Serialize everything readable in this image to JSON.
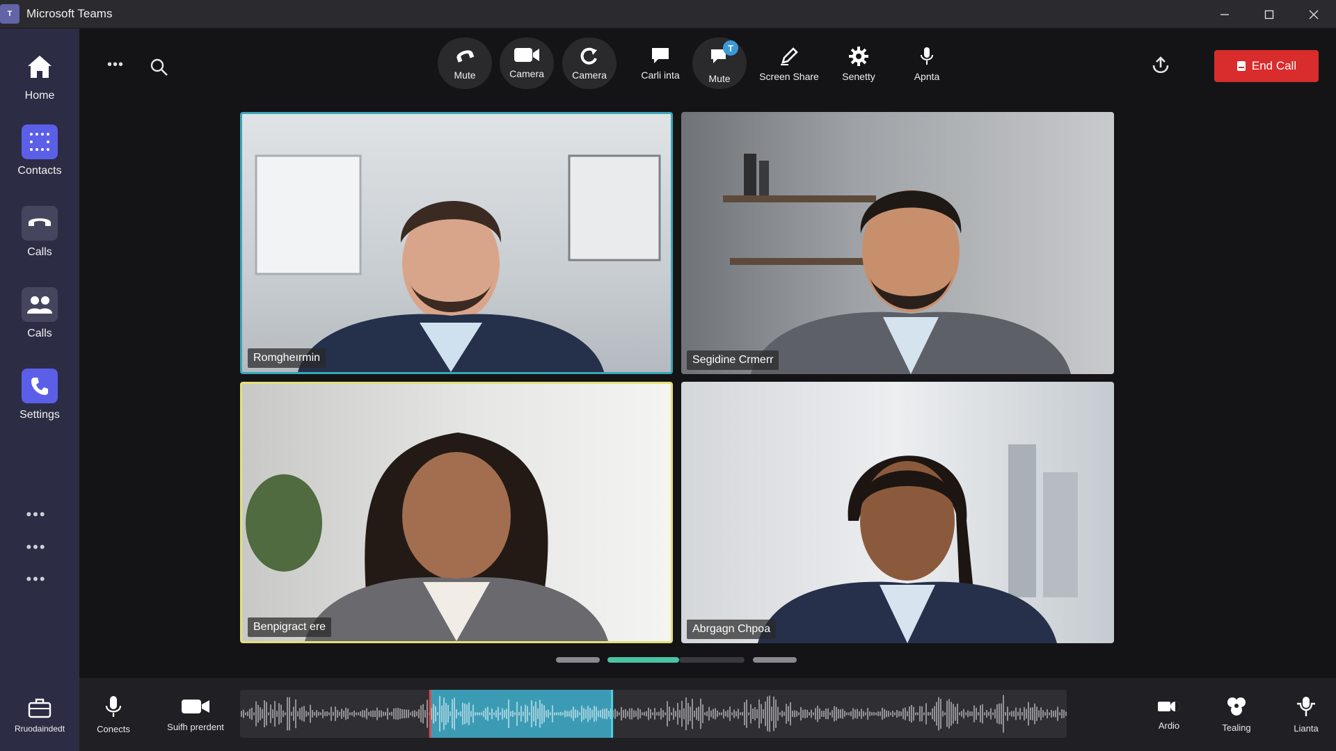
{
  "window": {
    "app_name": "Microsoft Teams",
    "logo_text": "T"
  },
  "nav": {
    "items": [
      {
        "label": "Home"
      },
      {
        "label": "Contacts"
      },
      {
        "label": "Calls"
      },
      {
        "label": "Calls"
      },
      {
        "label": "Settings"
      }
    ],
    "dots": [
      "•••",
      "•••",
      "•••"
    ],
    "bottom_label": "Rruodaindedt"
  },
  "toolbar": {
    "more": "•••",
    "tools": [
      {
        "label": "Mute",
        "icon": "headset-icon"
      },
      {
        "label": "Camera",
        "icon": "video-camera-icon"
      },
      {
        "label": "Camera",
        "icon": "switch-camera-icon"
      },
      {
        "label": "Carli inta",
        "icon": "chat-icon"
      },
      {
        "label": "Mute",
        "icon": "chat-badge-icon",
        "badge": "T"
      },
      {
        "label": "Screen Share",
        "icon": "pen-icon"
      },
      {
        "label": "Senetty",
        "icon": "gear-icon"
      },
      {
        "label": "Apnta",
        "icon": "microphone-icon"
      }
    ],
    "end_call": "End Call",
    "accent_red": "#d92c2c",
    "accent_purple": "#5b5fe8"
  },
  "participants": [
    {
      "name": "Romgheırmin",
      "highlight": "#3aa6b9"
    },
    {
      "name": "Segidine Crmerr",
      "highlight": ""
    },
    {
      "name": "Benpigract ere",
      "highlight": "#e3e07a"
    },
    {
      "name": "Abrgagn Chpoa",
      "highlight": ""
    }
  ],
  "pager": {
    "pages": 4,
    "active_page": 2
  },
  "bottom": {
    "left": [
      {
        "label": "Conects",
        "icon": "microphone-icon"
      },
      {
        "label": "Suifh prerdent",
        "icon": "video-camera-icon"
      }
    ],
    "right": [
      {
        "label": "Ardio",
        "icon": "speaker-icon"
      },
      {
        "label": "Tealing",
        "icon": "settings-cog-icon"
      },
      {
        "label": "Lianta",
        "icon": "mic-stand-icon"
      }
    ],
    "waveform_selection": [
      0.23,
      0.45
    ],
    "waveform_color": "#3c9bb4"
  }
}
